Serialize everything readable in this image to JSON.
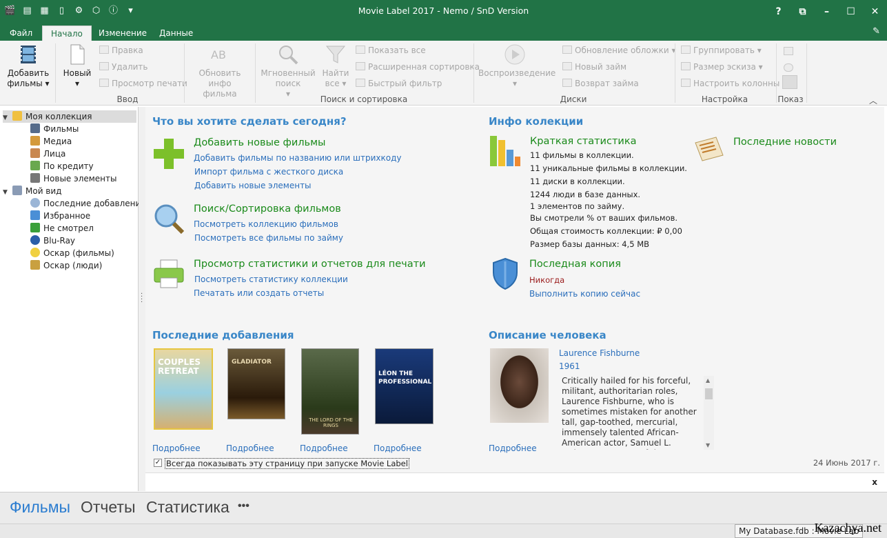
{
  "window": {
    "title": "Movie Label 2017 - Nemo / SnD Version",
    "controls": [
      "?",
      "⧉",
      "–",
      "☐",
      "✕"
    ]
  },
  "tabs": {
    "file": "Файл",
    "home": "Начало",
    "edit": "Изменение",
    "data": "Данные"
  },
  "ribbon": {
    "add_movies": "Добавить фильмы",
    "new": "Новый",
    "edit": "Правка",
    "delete": "Удалить",
    "print_preview": "Просмотр печати",
    "update_info": "Обновить инфо фильма",
    "quick_search": "Мгновенный поиск",
    "find_all": "Найти все",
    "show_all": "Показать все",
    "advanced_sort": "Расширенная сортировка",
    "quick_filter": "Быстрый фильтр",
    "playback": "Воспроизведение",
    "update_cover": "Обновление обложки",
    "new_loan": "Новый займ",
    "return_loan": "Возврат займа",
    "grouping": "Группировать",
    "thumb_size": "Размер эскиза",
    "columns": "Настроить колонны",
    "group_input": "Ввод",
    "group_search": "Поиск и сортировка",
    "group_disks": "Диски",
    "group_settings": "Настройка",
    "group_show": "Показ"
  },
  "sidebar": {
    "my_collection": "Моя коллекция",
    "items1": [
      "Фильмы",
      "Медиа",
      "Лица",
      "По кредиту",
      "Новые элементы"
    ],
    "my_view": "Мой вид",
    "items2": [
      "Последние добавления",
      "Избранное",
      "Не смотрел",
      "Blu-Ray",
      "Оскар (фильмы)",
      "Оскар (люди)"
    ]
  },
  "main": {
    "what_todo": "Что вы хотите сделать сегодня?",
    "add_title": "Добавить новые фильмы",
    "add_links": [
      "Добавить фильмы по названию или штрихкоду",
      "Импорт фильма с жесткого диска",
      "Добавить новые элементы"
    ],
    "search_title": "Поиск/Сортировка фильмов",
    "search_links": [
      "Посмотреть коллекцию фильмов",
      "Посмотреть все фильмы по займу"
    ],
    "stats_title": "Просмотр статистики и отчетов для печати",
    "stats_links": [
      "Посмотреть статистику коллекции",
      "Печатать или создать отчеты"
    ],
    "info_header": "Инфо колекции",
    "brief_stats": "Краткая статистика",
    "stats_lines": [
      "11 фильмы в коллекции.",
      "11 уникальные фильмы в коллекции.",
      "11 диски в коллекции.",
      "1244 люди в базе данных.",
      "1 элементов по займу.",
      "Вы смотрели % от ваших фильмов.",
      "Общая стоимость коллекции: ₽ 0,00",
      "Размер базы данных: 4,5 MB"
    ],
    "news": "Последние новости",
    "backup_title": "Последная копия",
    "backup_value": "Никогда",
    "backup_link": "Выполнить копию сейчас",
    "recent_header": "Последние добавления",
    "posters": [
      {
        "title": "COUPLES RETREAT",
        "more": "Подробнее"
      },
      {
        "title": "GLADIATOR",
        "more": "Подробнее"
      },
      {
        "title": "THE LORD OF THE RINGS",
        "more": "Подробнее"
      },
      {
        "title": "LÉON THE PROFESSIONAL",
        "more": "Подробнее"
      }
    ],
    "person_header": "Описание человека",
    "person_name": "Laurence Fishburne",
    "person_year": "1961",
    "person_more": "Подробнее",
    "person_desc": "Critically hailed for his forceful, militant, authoritarian roles, Laurence Fishburne, who is sometimes mistaken for another tall, gap-toothed, mercurial, immensely talented African-American actor, Samuel L. Jackson, came out of the",
    "always_show": "Всегда показывать эту страницу при запуске Movie Label",
    "date": "24 Июнь 2017 г.",
    "close": "x"
  },
  "bottomnav": {
    "movies": "Фильмы",
    "reports": "Отчеты",
    "stats": "Статистика",
    "more": "•••"
  },
  "status": {
    "db": "My Database.fdb  :  Movie Lab",
    "watermark": "Kazachya.net"
  },
  "colors": {
    "titlebar": "#217346",
    "link": "#2a6ebb",
    "header": "#3a87c8",
    "green_title": "#1a8a1a"
  }
}
